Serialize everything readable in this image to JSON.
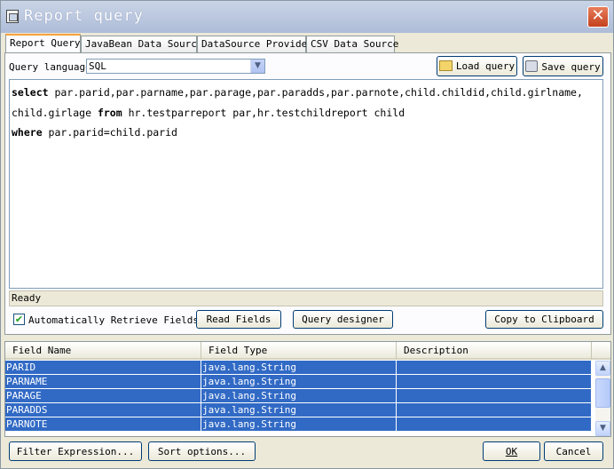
{
  "window": {
    "title": "Report query",
    "close_glyph": "✕",
    "app_icon": "report-icon"
  },
  "tabs": [
    {
      "label": "Report Query",
      "active": true
    },
    {
      "label": "JavaBean Data Source",
      "active": false
    },
    {
      "label": "DataSource Provider",
      "active": false
    },
    {
      "label": "CSV Data Source",
      "active": false
    }
  ],
  "query": {
    "language_label": "Query language",
    "language_value": "SQL",
    "load_label": "Load query",
    "save_label": "Save query",
    "lines": [
      [
        {
          "t": "select",
          "kw": true
        },
        {
          "t": " par.parid,par.parname,par.parage,par.paradds,par.parnote,child.childid,child.girlname,",
          "kw": false
        }
      ],
      [
        {
          "t": "child.girlage ",
          "kw": false
        },
        {
          "t": "from",
          "kw": true
        },
        {
          "t": " hr.testparreport par,hr.testchildreport child",
          "kw": false
        }
      ],
      [
        {
          "t": "where",
          "kw": true
        },
        {
          "t": " par.parid=child.parid",
          "kw": false
        }
      ]
    ],
    "status": "Ready",
    "auto_retrieve_label": "Automatically Retrieve Fields",
    "auto_retrieve_checked": true,
    "read_fields_label": "Read Fields",
    "query_designer_label": "Query designer",
    "copy_label": "Copy to Clipboard"
  },
  "fields": {
    "columns": [
      "Field Name",
      "Field Type",
      "Description"
    ],
    "rows": [
      {
        "name": "PARID",
        "type": "java.lang.String",
        "description": ""
      },
      {
        "name": "PARNAME",
        "type": "java.lang.String",
        "description": ""
      },
      {
        "name": "PARAGE",
        "type": "java.lang.String",
        "description": ""
      },
      {
        "name": "PARADDS",
        "type": "java.lang.String",
        "description": ""
      },
      {
        "name": "PARNOTE",
        "type": "java.lang.String",
        "description": ""
      }
    ]
  },
  "footer": {
    "filter_label": "Filter Expression...",
    "sort_label": "Sort options...",
    "ok_label": "OK",
    "cancel_label": "Cancel"
  },
  "colors": {
    "selection": "#316ac5",
    "tab_highlight": "#f7a23a",
    "title_bar": "#b7c4de"
  }
}
